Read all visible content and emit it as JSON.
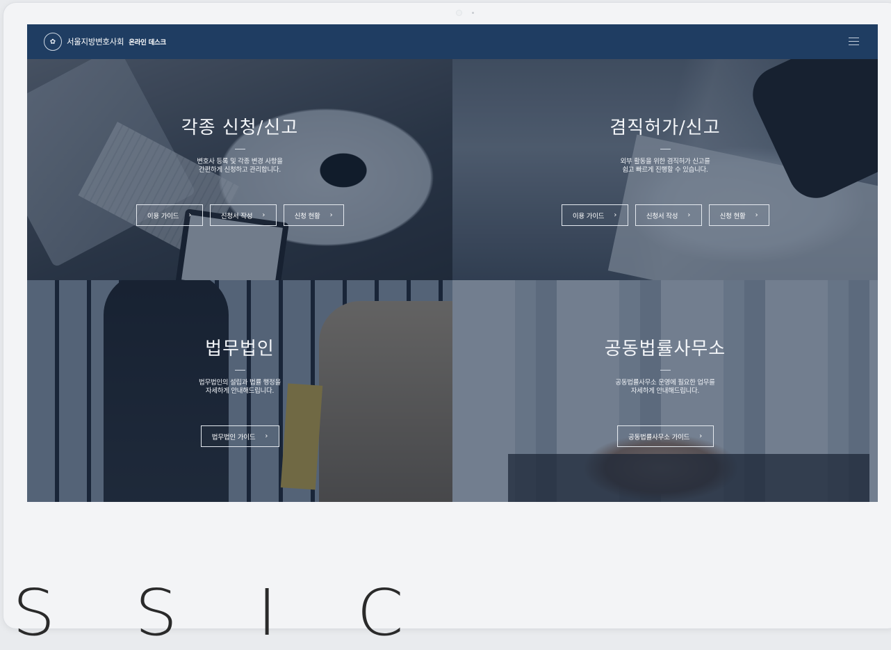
{
  "header": {
    "org_name": "서울지방변호사회",
    "service_name": "온라인 데스크",
    "logo_icon": "emblem-icon",
    "menu_icon": "hamburger-menu-icon"
  },
  "panels": [
    {
      "title": "각종 신청/신고",
      "desc_line1": "변호사 등록 및 각종 변경 사항을",
      "desc_line2": "간편하게 신청하고 관리합니다.",
      "buttons": [
        "이용 가이드",
        "신청서 작성",
        "신청 현황"
      ]
    },
    {
      "title": "겸직허가/신고",
      "desc_line1": "외부 활동을 위한 겸직허가 신고를",
      "desc_line2": "쉽고 빠르게 진행할 수 있습니다.",
      "buttons": [
        "이용 가이드",
        "신청서 작성",
        "신청 현황"
      ]
    },
    {
      "title": "법무법인",
      "desc_line1": "법무법인의 설립과 법률 행정을",
      "desc_line2": "자세하게 안내해드립니다.",
      "buttons": [
        "법무법인 가이드"
      ]
    },
    {
      "title": "공동법률사무소",
      "desc_line1": "공동법률사무소 운영에 필요한 업무를",
      "desc_line2": "자세하게 안내해드립니다.",
      "buttons": [
        "공동법률사무소 가이드"
      ]
    }
  ],
  "chevron": "›",
  "footer_text": "S S I C",
  "colors": {
    "navbar": "#1f3d62",
    "overlay": "#162640",
    "frame": "#f3f4f6"
  }
}
